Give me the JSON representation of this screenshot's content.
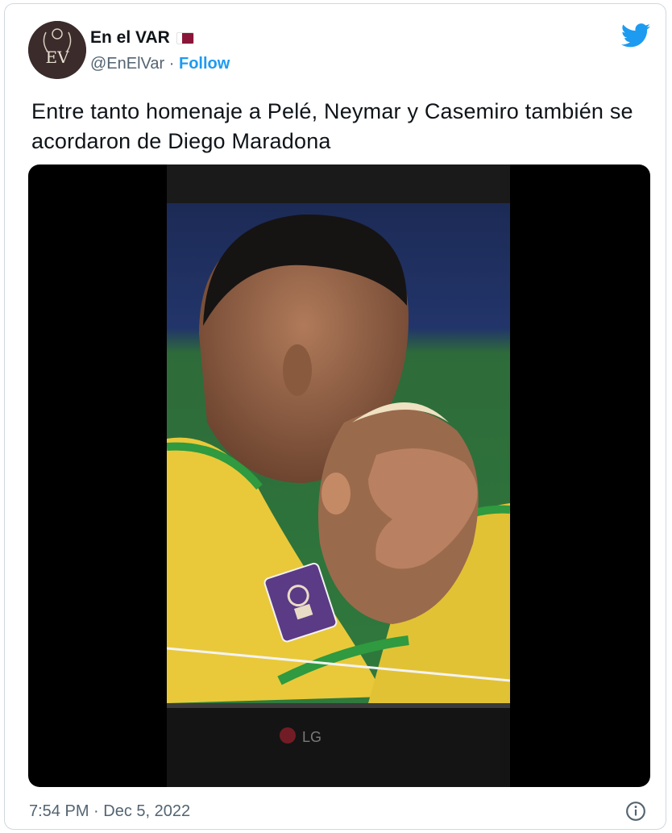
{
  "tweet": {
    "display_name": "En el VAR",
    "flag": "qatar-flag-icon",
    "handle": "@EnElVar",
    "separator": "·",
    "follow_label": "Follow",
    "avatar_monogram": "EV",
    "text": "Entre tanto homenaje a Pelé, Neymar y Casemiro también se acordaron de Diego Maradona",
    "media": {
      "type": "video",
      "tv_brand": "LG"
    },
    "timestamp": "7:54 PM · Dec 5, 2022"
  },
  "colors": {
    "accent": "#1d9bf0",
    "text_primary": "#0f1419",
    "text_secondary": "#536471",
    "border": "#cfd9de",
    "jersey_yellow": "#f2d23c",
    "jersey_green": "#2f9a3f"
  },
  "icons": {
    "brand": "twitter-bird-icon",
    "info": "info-icon"
  }
}
